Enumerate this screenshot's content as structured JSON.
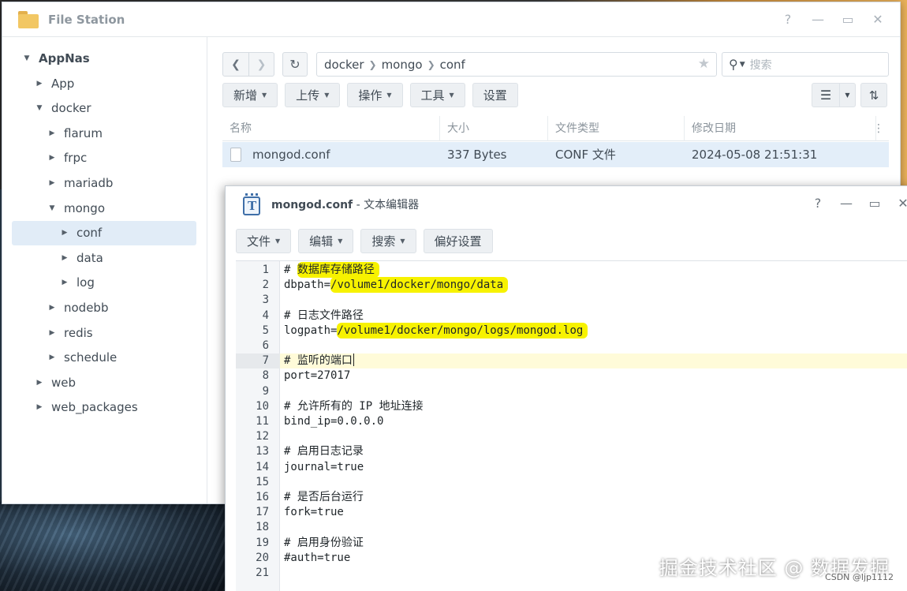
{
  "file_station": {
    "title": "File Station",
    "controls": {
      "help": "?",
      "minimize": "—",
      "maximize": "▭",
      "close": "✕"
    },
    "tree": [
      {
        "label": "AppNas",
        "level": 0,
        "expanded": true,
        "root": true
      },
      {
        "label": "App",
        "level": 1,
        "expanded": false
      },
      {
        "label": "docker",
        "level": 1,
        "expanded": true
      },
      {
        "label": "flarum",
        "level": 2,
        "expanded": false
      },
      {
        "label": "frpc",
        "level": 2,
        "expanded": false
      },
      {
        "label": "mariadb",
        "level": 2,
        "expanded": false
      },
      {
        "label": "mongo",
        "level": 2,
        "expanded": true
      },
      {
        "label": "conf",
        "level": 3,
        "expanded": false,
        "selected": true
      },
      {
        "label": "data",
        "level": 3,
        "expanded": false
      },
      {
        "label": "log",
        "level": 3,
        "expanded": false
      },
      {
        "label": "nodebb",
        "level": 2,
        "expanded": false
      },
      {
        "label": "redis",
        "level": 2,
        "expanded": false
      },
      {
        "label": "schedule",
        "level": 2,
        "expanded": false
      },
      {
        "label": "web",
        "level": 1,
        "expanded": false
      },
      {
        "label": "web_packages",
        "level": 1,
        "expanded": false
      }
    ],
    "path": [
      "docker",
      "mongo",
      "conf"
    ],
    "search_placeholder": "搜索",
    "toolbar": {
      "new": "新增",
      "upload": "上传",
      "action": "操作",
      "tools": "工具",
      "settings": "设置"
    },
    "columns": [
      "名称",
      "大小",
      "文件类型",
      "修改日期"
    ],
    "files": [
      {
        "name": "mongod.conf",
        "size": "337 Bytes",
        "type": "CONF 文件",
        "modified": "2024-05-08 21:51:31"
      }
    ]
  },
  "text_editor": {
    "file_name": "mongod.conf",
    "title_suffix": " - 文本编辑器",
    "controls": {
      "help": "?",
      "minimize": "—",
      "maximize": "▭",
      "close": "✕"
    },
    "menu": {
      "file": "文件",
      "edit": "编辑",
      "search": "搜索",
      "preferences": "偏好设置"
    },
    "current_line": 7,
    "lines": [
      "# 数据库存储路径",
      "dbpath=/volume1/docker/mongo/data",
      "",
      "# 日志文件路径",
      "logpath=/volume1/docker/mongo/logs/mongod.log",
      "",
      "# 监听的端口",
      "port=27017",
      "",
      "# 允许所有的 IP 地址连接",
      "bind_ip=0.0.0.0",
      "",
      "# 启用日志记录",
      "journal=true",
      "",
      "# 是否后台运行",
      "fork=true",
      "",
      "# 启用身份验证",
      "#auth=true",
      ""
    ],
    "highlights": [
      {
        "line": 1,
        "prefix": "# ",
        "text": "数据库存储路径"
      },
      {
        "line": 2,
        "prefix": "dbpath=",
        "text": "/volume1/docker/mongo/data"
      },
      {
        "line": 5,
        "prefix": "logpath=",
        "text": "/volume1/docker/mongo/logs/mongod.log"
      }
    ],
    "highlight_color": "#f7f200"
  },
  "watermark": "掘金技术社区 @ 数据发掘",
  "credit": "CSDN @ljp1112"
}
